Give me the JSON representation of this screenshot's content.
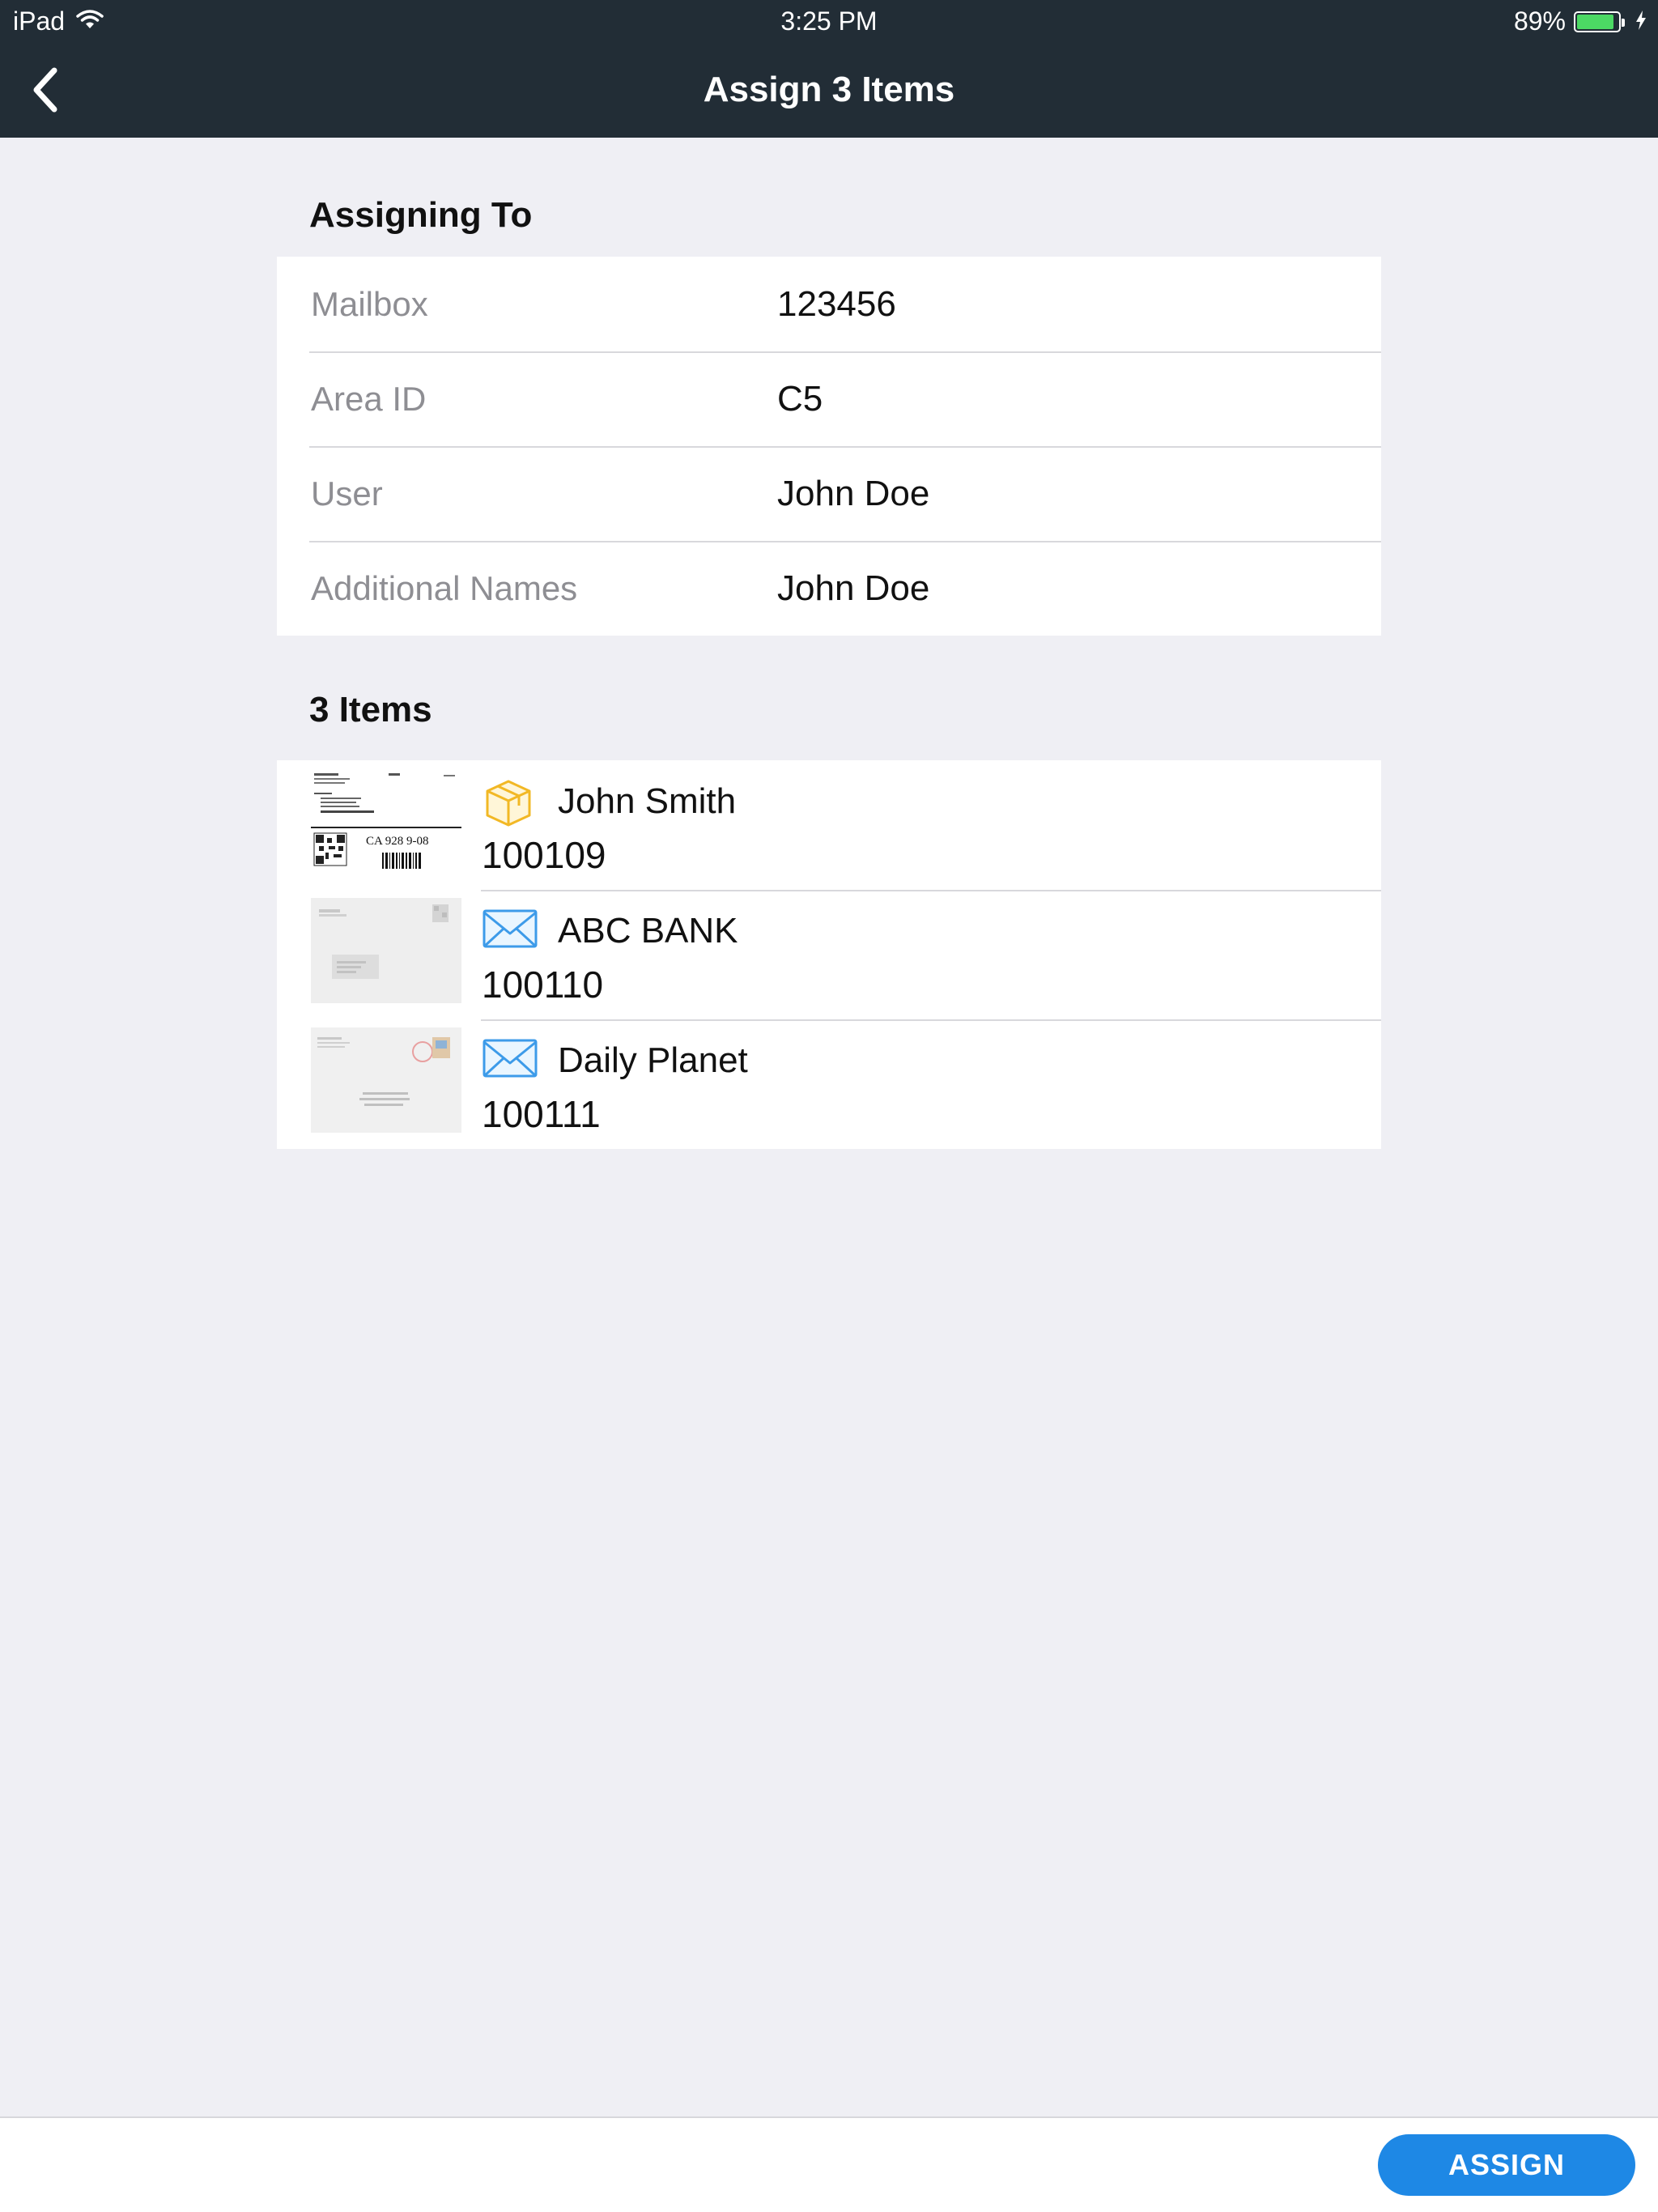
{
  "status_bar": {
    "device": "iPad",
    "time": "3:25 PM",
    "battery_percent": "89%",
    "battery_level": 0.89,
    "battery_color": "#4cd964"
  },
  "nav": {
    "back_icon": "chevron-left-icon",
    "title": "Assign 3 Items"
  },
  "assigning": {
    "header": "Assigning To",
    "rows": [
      {
        "label": "Mailbox",
        "value": "123456"
      },
      {
        "label": "Area ID",
        "value": "C5"
      },
      {
        "label": "User",
        "value": "John Doe"
      },
      {
        "label": "Additional Names",
        "value": "John Doe"
      }
    ]
  },
  "items": {
    "header": "3 Items",
    "list": [
      {
        "icon": "package-icon",
        "name": "John Smith",
        "code": "100109",
        "thumb_text": "CA 928 9-08"
      },
      {
        "icon": "envelope-icon",
        "name": "ABC BANK",
        "code": "100110"
      },
      {
        "icon": "envelope-icon",
        "name": "Daily Planet",
        "code": "100111"
      }
    ]
  },
  "footer": {
    "assign_label": "ASSIGN",
    "accent_color": "#1e88e5"
  }
}
